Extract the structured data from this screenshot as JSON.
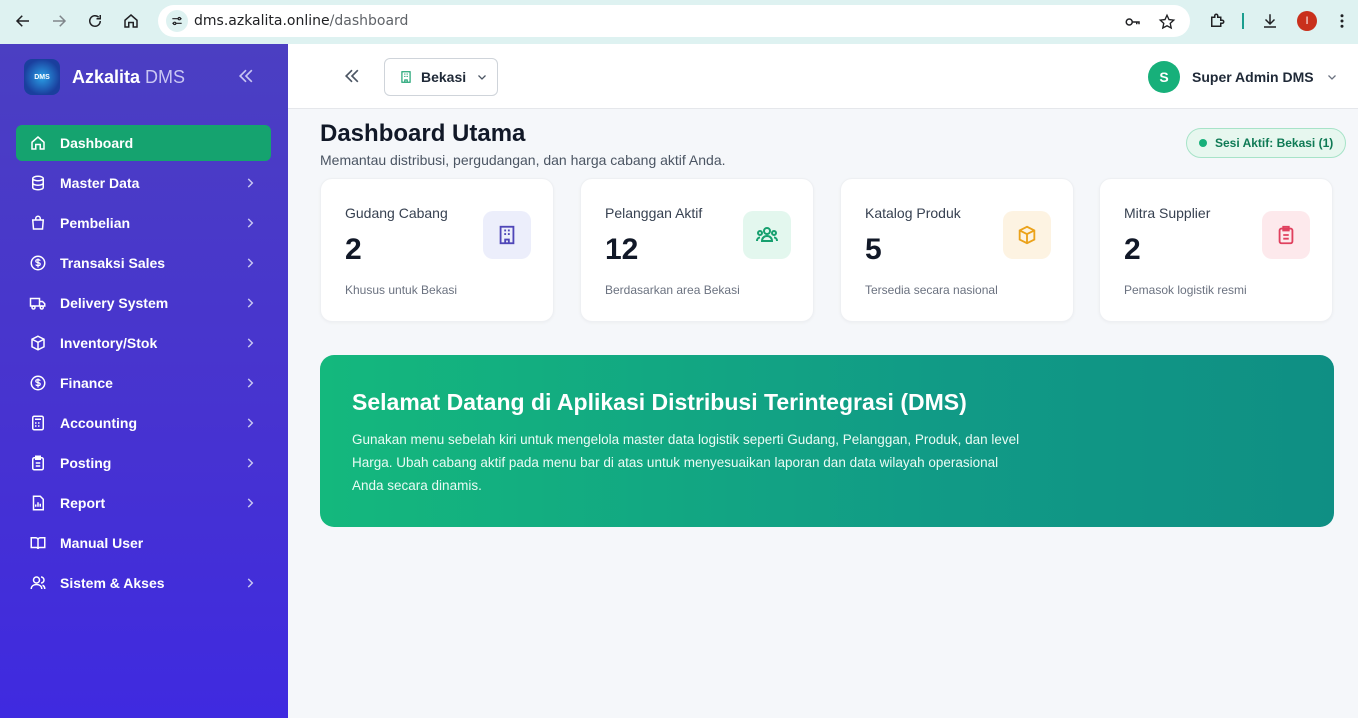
{
  "browser": {
    "url_host": "dms.azkalita.online",
    "url_path": "/dashboard",
    "profile_initial": "I"
  },
  "sidebar": {
    "brand_logo_text": "DMS",
    "brand_name_1": "Azkalita",
    "brand_name_2": " DMS",
    "items": [
      {
        "label": "Dashboard",
        "icon": "home-icon",
        "active": true,
        "chevron": false
      },
      {
        "label": "Master Data",
        "icon": "database-icon",
        "chevron": true
      },
      {
        "label": "Pembelian",
        "icon": "shopping-bag-icon",
        "chevron": true
      },
      {
        "label": "Transaksi Sales",
        "icon": "dollar-circle-icon",
        "chevron": true
      },
      {
        "label": "Delivery System",
        "icon": "truck-icon",
        "chevron": true
      },
      {
        "label": "Inventory/Stok",
        "icon": "box-icon",
        "chevron": true
      },
      {
        "label": "Finance",
        "icon": "dollar-circle-icon",
        "chevron": true
      },
      {
        "label": "Accounting",
        "icon": "calculator-icon",
        "chevron": true
      },
      {
        "label": "Posting",
        "icon": "clipboard-icon",
        "chevron": true
      },
      {
        "label": "Report",
        "icon": "report-icon",
        "chevron": true
      },
      {
        "label": "Manual User",
        "icon": "book-icon",
        "chevron": false
      },
      {
        "label": "Sistem & Akses",
        "icon": "users-icon",
        "chevron": true
      }
    ]
  },
  "topbar": {
    "branch": "Bekasi",
    "user_initial": "S",
    "user_name": "Super Admin DMS"
  },
  "main": {
    "title": "Dashboard Utama",
    "subtitle": "Memantau distribusi, pergudangan, dan harga cabang aktif Anda.",
    "session_badge": "Sesi Aktif: Bekasi (1)",
    "cards": [
      {
        "title": "Gudang Cabang",
        "value": "2",
        "note": "Khusus untuk Bekasi",
        "icon": "building-icon",
        "icon_bg": "#eceefb",
        "icon_color": "#4f46b8"
      },
      {
        "title": "Pelanggan Aktif",
        "value": "12",
        "note": "Berdasarkan area Bekasi",
        "icon": "users-icon",
        "icon_bg": "#e3f7ee",
        "icon_color": "#17a06f"
      },
      {
        "title": "Katalog Produk",
        "value": "5",
        "note": "Tersedia secara nasional",
        "icon": "box-icon",
        "icon_bg": "#fdf3e2",
        "icon_color": "#eba21a"
      },
      {
        "title": "Mitra Supplier",
        "value": "2",
        "note": "Pemasok logistik resmi",
        "icon": "clipboard-icon",
        "icon_bg": "#fde9ec",
        "icon_color": "#e0405e"
      }
    ],
    "welcome": {
      "title": "Selamat Datang di Aplikasi Distribusi Terintegrasi (DMS)",
      "text": "Gunakan menu sebelah kiri untuk mengelola master data logistik seperti Gudang, Pelanggan, Produk, dan level Harga. Ubah cabang aktif pada menu bar di atas untuk menyesuaikan laporan dan data wilayah operasional Anda secara dinamis."
    }
  }
}
